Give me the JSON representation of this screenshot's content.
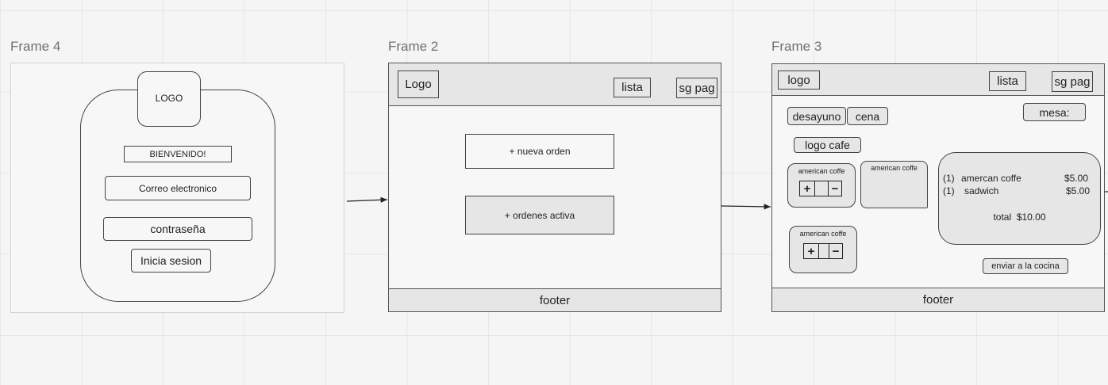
{
  "frames": {
    "login": {
      "title": "Frame 4",
      "logo": "LOGO",
      "welcome": "BIENVENIDO!",
      "email": "Correo electronico",
      "password": "contraseña",
      "login_button": "Inicia sesion"
    },
    "home": {
      "title": "Frame 2",
      "logo": "Logo",
      "nav_list": "lista",
      "nav_next": "sg pag",
      "new_order": "+ nueva orden",
      "active_orders": "+ ordenes activa",
      "footer": "footer"
    },
    "order": {
      "title": "Frame 3",
      "logo": "logo",
      "nav_list": "lista",
      "nav_next": "sg pag",
      "tab_breakfast": "desayuno",
      "tab_dinner": "cena",
      "table": "mesa:",
      "cafe_logo": "logo cafe",
      "product_1": "american coffe",
      "product_2": "american coffe",
      "product_3": "american coffe",
      "plus": "+",
      "minus": "−",
      "summary": {
        "items": [
          {
            "qty": "(1)",
            "name": "amercan coffe",
            "price": "$5.00"
          },
          {
            "qty": "(1)",
            "name": "sadwich",
            "price": "$5.00"
          }
        ],
        "total": "total  $10.00"
      },
      "send_button": "enviar a la cocina",
      "footer": "footer"
    }
  }
}
